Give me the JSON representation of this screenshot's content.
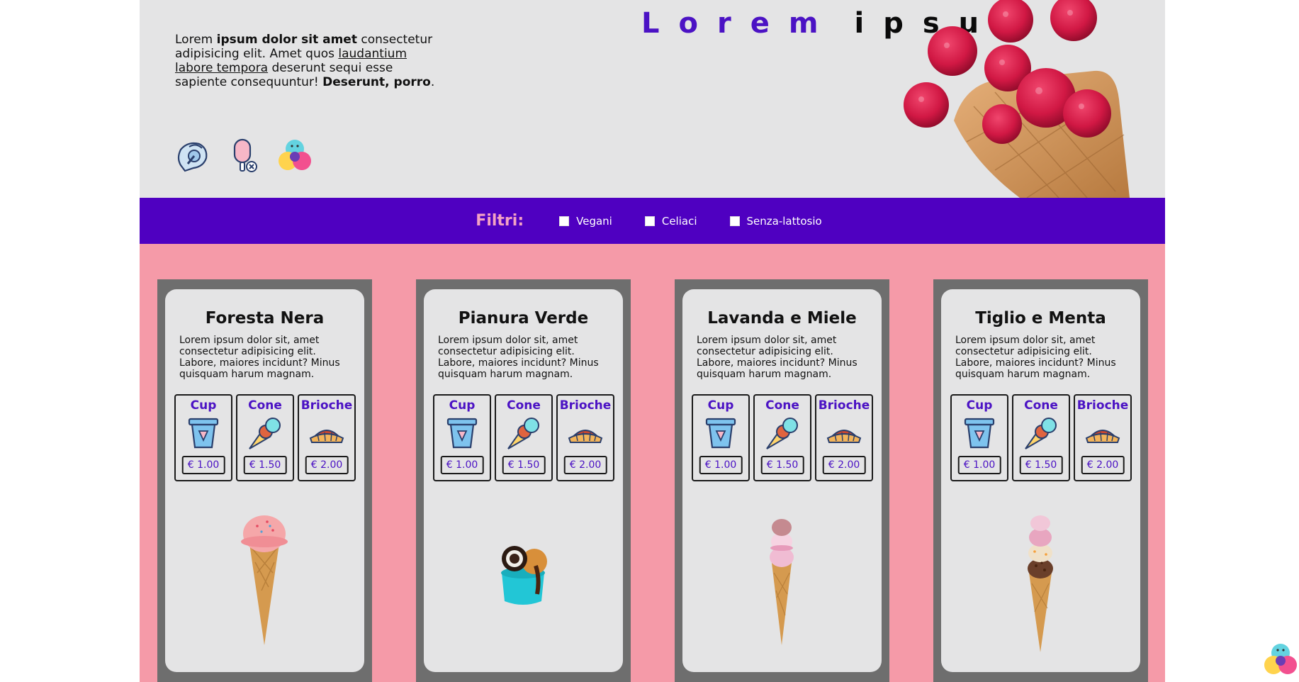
{
  "header": {
    "intro": {
      "p1": "Lorem ",
      "b1": "ipsum dolor sit amet",
      "p2": " consectetur adipisicing elit. Amet quos ",
      "u1": "laudantium labore tempora",
      "p3": " deserunt sequi esse sapiente consequuntur! ",
      "b2": "Deserunt, porro",
      "p4": "."
    },
    "title_word1": "Lorem",
    "title_word2": "ipsum",
    "icons": [
      "ice-cream-chat-icon",
      "popsicle-icon",
      "ice-cream-scoops-icon"
    ]
  },
  "filters": {
    "title": "Filtri:",
    "options": [
      {
        "label": "Vegani",
        "checked": false
      },
      {
        "label": "Celiaci",
        "checked": false
      },
      {
        "label": "Senza-lattosio",
        "checked": false
      }
    ]
  },
  "cards": [
    {
      "title": "Foresta Nera",
      "description": "Lorem ipsum dolor sit, amet consectetur adipisicing elit. Labore, maiores incidunt? Minus quisquam harum magnam.",
      "options": [
        {
          "name": "Cup",
          "price": "€ 1.00"
        },
        {
          "name": "Cone",
          "price": "€ 1.50"
        },
        {
          "name": "Brioche",
          "price": "€ 2.00"
        }
      ],
      "image": "pink-ice-cream-cone"
    },
    {
      "title": "Pianura Verde",
      "description": "Lorem ipsum dolor sit, amet consectetur adipisicing elit. Labore, maiores incidunt? Minus quisquam harum magnam.",
      "options": [
        {
          "name": "Cup",
          "price": "€ 1.00"
        },
        {
          "name": "Cone",
          "price": "€ 1.50"
        },
        {
          "name": "Brioche",
          "price": "€ 2.00"
        }
      ],
      "image": "ice-cream-cup-with-cookie"
    },
    {
      "title": "Lavanda e Miele",
      "description": "Lorem ipsum dolor sit, amet consectetur adipisicing elit. Labore, maiores incidunt? Minus quisquam harum magnam.",
      "options": [
        {
          "name": "Cup",
          "price": "€ 1.00"
        },
        {
          "name": "Cone",
          "price": "€ 1.50"
        },
        {
          "name": "Brioche",
          "price": "€ 2.00"
        }
      ],
      "image": "stacked-ice-cream-cone"
    },
    {
      "title": "Tiglio e Menta",
      "description": "Lorem ipsum dolor sit, amet consectetur adipisicing elit. Labore, maiores incidunt? Minus quisquam harum magnam.",
      "options": [
        {
          "name": "Cup",
          "price": "€ 1.00"
        },
        {
          "name": "Cone",
          "price": "€ 1.50"
        },
        {
          "name": "Brioche",
          "price": "€ 2.00"
        }
      ],
      "image": "tall-scoops-ice-cream-cone"
    }
  ],
  "colors": {
    "accent_purple": "#4f00c1",
    "title_purple": "#4b12c4",
    "filter_title_pink": "#f4a2c4",
    "page_pink": "#f59aa8",
    "card_bg": "#e4e4e5",
    "card_frame": "#6e6e6e"
  }
}
